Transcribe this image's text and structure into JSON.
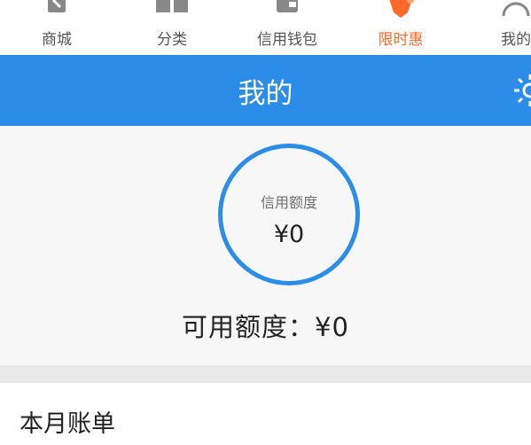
{
  "tabs": [
    {
      "label": "商城",
      "icon": "store-icon"
    },
    {
      "label": "分类",
      "icon": "grid-icon"
    },
    {
      "label": "信用钱包",
      "icon": "wallet-icon"
    },
    {
      "label": "限时惠",
      "icon": "flash-sale-tag-icon",
      "active": true
    },
    {
      "label": "我的",
      "icon": "user-icon"
    }
  ],
  "header": {
    "title": "我的"
  },
  "credit": {
    "ring_label": "信用额度",
    "ring_amount": "¥0",
    "available": "可用额度：¥0"
  },
  "bill": {
    "label": "本月账单"
  },
  "colors": {
    "primary": "#2b8de8",
    "accent": "#ff6a2a"
  }
}
